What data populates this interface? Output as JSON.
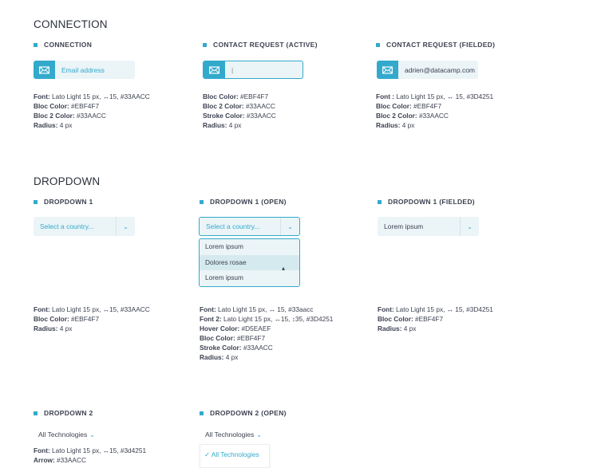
{
  "connection": {
    "title": "CONNECTION",
    "items": [
      {
        "heading": "CONNECTION",
        "value": "Email address",
        "specs": [
          {
            "k": "Font:",
            "v": " Lato Light 15 px, ↔15, #33AACC"
          },
          {
            "k": "Bloc Color:",
            "v": " #EBF4F7"
          },
          {
            "k": "Bloc 2 Color:",
            "v": " #33AACC"
          },
          {
            "k": "Radius:",
            "v": " 4 px"
          }
        ]
      },
      {
        "heading": "CONTACT REQUEST (ACTIVE)",
        "value": "|",
        "specs": [
          {
            "k": "Bloc Color:",
            "v": " #EBF4F7"
          },
          {
            "k": "Bloc 2 Color:",
            "v": " #33AACC"
          },
          {
            "k": "Stroke Color:",
            "v": " #33AACC"
          },
          {
            "k": "Radius:",
            "v": " 4 px"
          }
        ]
      },
      {
        "heading": "CONTACT REQUEST (FIELDED)",
        "value": "adrien@datacamp.com",
        "specs": [
          {
            "k": "Font :",
            "v": " Lato Light 15 px, ↔ 15, #3D4251"
          },
          {
            "k": "Bloc Color:",
            "v": " #EBF4F7"
          },
          {
            "k": "Bloc 2 Color:",
            "v": " #33AACC"
          },
          {
            "k": "Radius:",
            "v": " 4 px"
          }
        ]
      }
    ]
  },
  "dropdown": {
    "title": "DROPDOWN",
    "items": [
      {
        "heading": "DROPDOWN 1",
        "value": "Select a country...",
        "specs": [
          {
            "k": "Font:",
            "v": " Lato Light 15 px, ↔15, #33AACC"
          },
          {
            "k": "Bloc Color:",
            "v": " #EBF4F7"
          },
          {
            "k": "Radius:",
            "v": " 4 px"
          }
        ]
      },
      {
        "heading": "DROPDOWN 1 (OPEN)",
        "value": "Select a country...",
        "options": [
          "Lorem ipsum",
          "Dolores rosae",
          "Lorem ipsum"
        ],
        "specs": [
          {
            "k": "Font:",
            "v": " Lato Light 15 px,  ↔ 15, #33aacc"
          },
          {
            "k": "Font 2:",
            "v": " Lato Light 15 px, ↔15,  ↕35, #3D4251"
          },
          {
            "k": "Hover Color:",
            "v": " #D5EAEF"
          },
          {
            "k": "Bloc Color:",
            "v": " #EBF4F7"
          },
          {
            "k": "Stroke Color:",
            "v": " #33AACC"
          },
          {
            "k": "Radius:",
            "v": " 4 px"
          }
        ]
      },
      {
        "heading": "DROPDOWN 1 (FIELDED)",
        "value": "Lorem ipsum",
        "specs": [
          {
            "k": "Font:",
            "v": " Lato Light 15 px,  ↔ 15, #3D4251"
          },
          {
            "k": "Bloc Color:",
            "v": " #EBF4F7"
          },
          {
            "k": "Radius:",
            "v": " 4 px"
          }
        ]
      }
    ],
    "items2": [
      {
        "heading": "DROPDOWN 2",
        "value": "All Technologies",
        "specs": [
          {
            "k": "Font:",
            "v": " Lato Light 15 px, ↔15, #3d4251"
          },
          {
            "k": "Arrow:",
            "v": " #33AACC"
          }
        ]
      },
      {
        "heading": "DROPDOWN 2 (OPEN)",
        "value": "All Technologies",
        "options": [
          "All Technologies"
        ]
      }
    ]
  },
  "colors": {
    "accent": "#33AACC",
    "text": "#3D4251",
    "bloc": "#EBF4F7",
    "hover": "#D5EAEF"
  }
}
